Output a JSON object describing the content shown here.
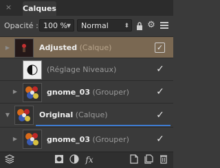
{
  "panel": {
    "close_glyph": "×",
    "tab_label": "Calques"
  },
  "toolbar": {
    "opacity_label": "Opacité :",
    "opacity_value": "100 %",
    "blend_mode": "Normal",
    "icons": [
      "lock-icon",
      "gear-icon",
      "menu-lines-icon"
    ]
  },
  "layers": [
    {
      "name": "Adjusted",
      "type": "(Calque)",
      "selected": true,
      "visible": true,
      "expanded": false,
      "bold": true
    },
    {
      "name": "",
      "type": "(Réglage Niveaux)",
      "selected": false,
      "visible": true,
      "bold": false
    },
    {
      "name": "gnome_03",
      "type": "(Grouper)",
      "selected": false,
      "visible": true,
      "expanded": false,
      "bold": true
    },
    {
      "name": "Original",
      "type": "(Calque)",
      "selected": false,
      "visible": true,
      "expanded": true,
      "bold": true
    },
    {
      "name": "gnome_03",
      "type": "(Grouper)",
      "selected": false,
      "visible": true,
      "expanded": false,
      "bold": true
    }
  ],
  "bottom_bar": {
    "icons": [
      "layers-stack-icon",
      "mask-icon",
      "adjustment-icon",
      "fx-icon",
      "add-layer-icon",
      "group-icon",
      "delete-icon"
    ],
    "fx_label": "fx"
  },
  "colors": {
    "selection": "#7a6852",
    "accent_blue": "#3e7bd0",
    "panel_bg": "#3a3a3a"
  }
}
